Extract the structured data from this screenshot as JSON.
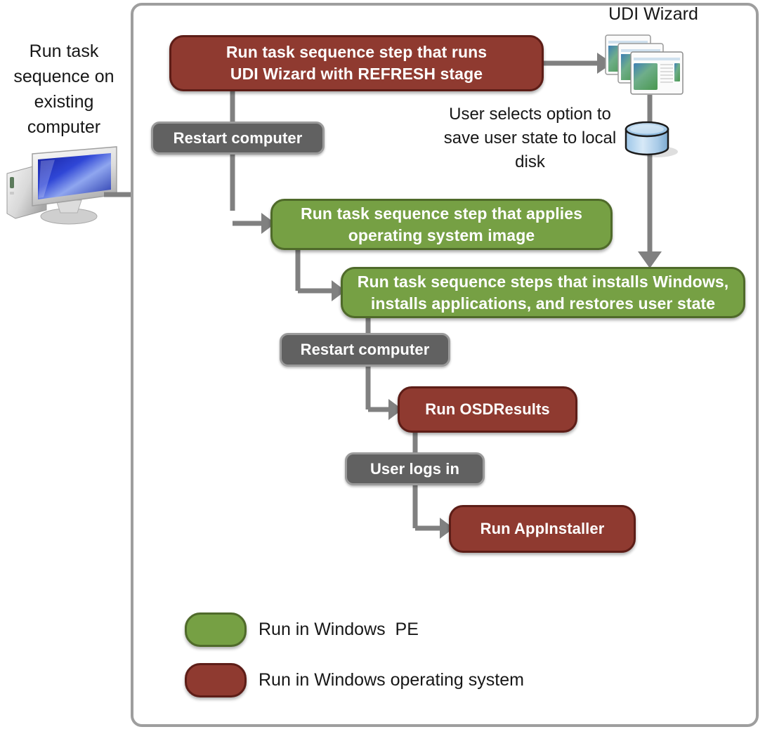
{
  "diagram": {
    "left_caption": "Run task sequence on existing computer",
    "udi_wizard_label": "UDI Wizard",
    "user_option_note": "User selects option to save user state to local disk",
    "icons": {
      "computer": "computer-monitor-icon",
      "udi_wizard": "stacked-wizard-windows-icon",
      "disk": "local-disk-cylinder-icon"
    },
    "nodes": [
      {
        "id": "udi-step",
        "label": "Run task sequence step  that runs UDI Wizard with REFRESH  stage",
        "line1": "Run task sequence step  that runs",
        "line2": "UDI Wizard with REFRESH  stage",
        "kind": "red"
      },
      {
        "id": "restart-1",
        "label": "Restart computer",
        "kind": "gray"
      },
      {
        "id": "apply-os",
        "label": "Run  task sequence step that applies operating system image",
        "line1": "Run  task sequence step that applies",
        "line2": "operating system image",
        "kind": "green"
      },
      {
        "id": "install-steps",
        "label": "Run task sequence steps that installs Windows, installs applications, and restores user state",
        "line1": "Run task sequence steps that installs Windows,",
        "line2": "installs applications, and restores user state",
        "kind": "green"
      },
      {
        "id": "restart-2",
        "label": "Restart computer",
        "kind": "gray"
      },
      {
        "id": "osdresults",
        "label": "Run OSDResults",
        "kind": "red"
      },
      {
        "id": "user-logs-in",
        "label": "User logs in",
        "kind": "gray"
      },
      {
        "id": "appinstaller",
        "label": "Run AppInstaller",
        "kind": "red"
      }
    ],
    "legend": [
      {
        "id": "pe",
        "label": "Run in Windows  PE",
        "color": "#76a044"
      },
      {
        "id": "os",
        "label": "Run in Windows operating system",
        "color": "#8f3a30"
      }
    ],
    "colors": {
      "green_fill": "#76a044",
      "green_border": "#4f6a2a",
      "red_fill": "#8f3a30",
      "red_border": "#5d1d17",
      "gray_fill": "#616161",
      "gray_border": "#9b9b9b",
      "connector": "#808080",
      "frame_border": "#9e9e9e",
      "text_dark": "#171717",
      "text_light": "#ffffff"
    }
  }
}
